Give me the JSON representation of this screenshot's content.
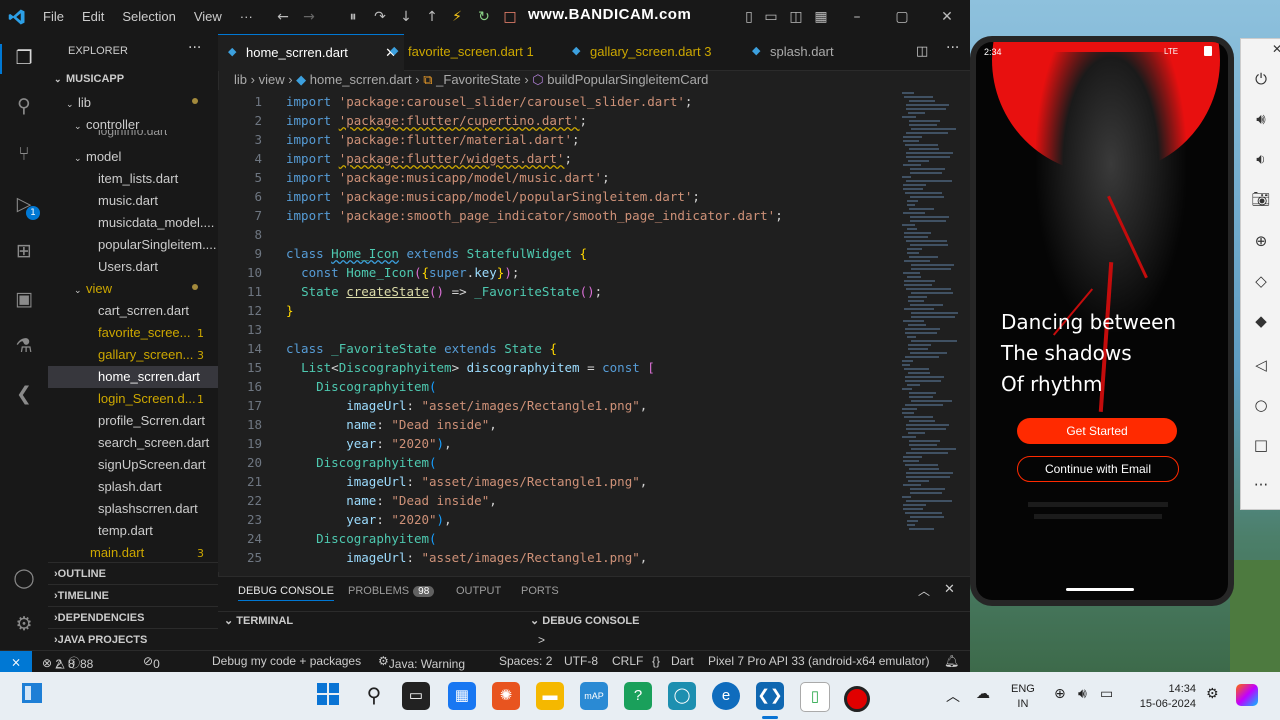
{
  "vscode": {
    "menu": [
      "File",
      "Edit",
      "Selection",
      "View",
      "···"
    ],
    "watermark": "www.BANDICAM.com",
    "explorer_title": "EXPLORER",
    "project": "MUSICAPP",
    "tree": {
      "lib": "lib",
      "controller": "controller",
      "controller_child": "loginInfo.dart",
      "model": "model",
      "model_files": [
        "item_lists.dart",
        "music.dart",
        "musicdata_model....",
        "popularSingleitem....",
        "Users.dart"
      ],
      "view": "view",
      "view_files": [
        {
          "name": "cart_scrren.dart",
          "badge": ""
        },
        {
          "name": "favorite_scree...",
          "badge": "1"
        },
        {
          "name": "gallary_screen...",
          "badge": "3"
        },
        {
          "name": "home_scrren.dart",
          "badge": ""
        },
        {
          "name": "login_Screen.d...",
          "badge": "1"
        },
        {
          "name": "profile_Scrren.dart",
          "badge": ""
        },
        {
          "name": "search_screen.dart",
          "badge": ""
        },
        {
          "name": "signUpScreen.dart",
          "badge": ""
        },
        {
          "name": "splash.dart",
          "badge": ""
        },
        {
          "name": "splashscrren.dart",
          "badge": ""
        },
        {
          "name": "temp.dart",
          "badge": ""
        }
      ],
      "main_file": "main.dart",
      "main_badge": "3"
    },
    "sections": [
      "OUTLINE",
      "TIMELINE",
      "DEPENDENCIES",
      "JAVA PROJECTS"
    ],
    "tabs": [
      {
        "label": "home_scrren.dart",
        "badge": ""
      },
      {
        "label": "favorite_screen.dart",
        "badge": "1"
      },
      {
        "label": "gallary_screen.dart",
        "badge": "3"
      },
      {
        "label": "splash.dart",
        "badge": ""
      }
    ],
    "breadcrumb": [
      "lib",
      "view",
      "home_scrren.dart",
      "_FavoriteState",
      "buildPopularSingleitemCard"
    ],
    "line_numbers": [
      "1",
      "2",
      "3",
      "4",
      "5",
      "6",
      "7",
      "8",
      "9",
      "10",
      "11",
      "12",
      "13",
      "14",
      "15",
      "16",
      "17",
      "18",
      "19",
      "20",
      "21",
      "22",
      "23",
      "24",
      "25"
    ],
    "panel": {
      "tabs": [
        "DEBUG CONSOLE",
        "PROBLEMS",
        "OUTPUT",
        "PORTS"
      ],
      "problems_count": "98",
      "terminal": "TERMINAL",
      "debug_console": "DEBUG CONSOLE",
      "prompt": ">"
    },
    "status": {
      "errors": "2",
      "warnings": "8",
      "info": "88",
      "ports": "0",
      "debug": "Debug my code + packages",
      "java": "Java: Warning",
      "spaces": "Spaces: 2",
      "encoding": "UTF-8",
      "eol": "CRLF",
      "braces": "{}",
      "language": "Dart",
      "device": "Pixel 7 Pro API 33 (android-x64 emulator)"
    }
  },
  "phone": {
    "time": "2:34",
    "network": "LTE",
    "headline": [
      "Dancing between",
      "The shadows",
      "Of rhythm"
    ],
    "primary_button": "Get Started",
    "secondary_button": "Continue with Email",
    "colors": {
      "accent": "#ff2a00",
      "sun": "#e8100f"
    }
  },
  "taskbar": {
    "lang_top": "ENG",
    "lang_bottom": "IN",
    "time": "14:34",
    "date": "15-06-2024"
  }
}
